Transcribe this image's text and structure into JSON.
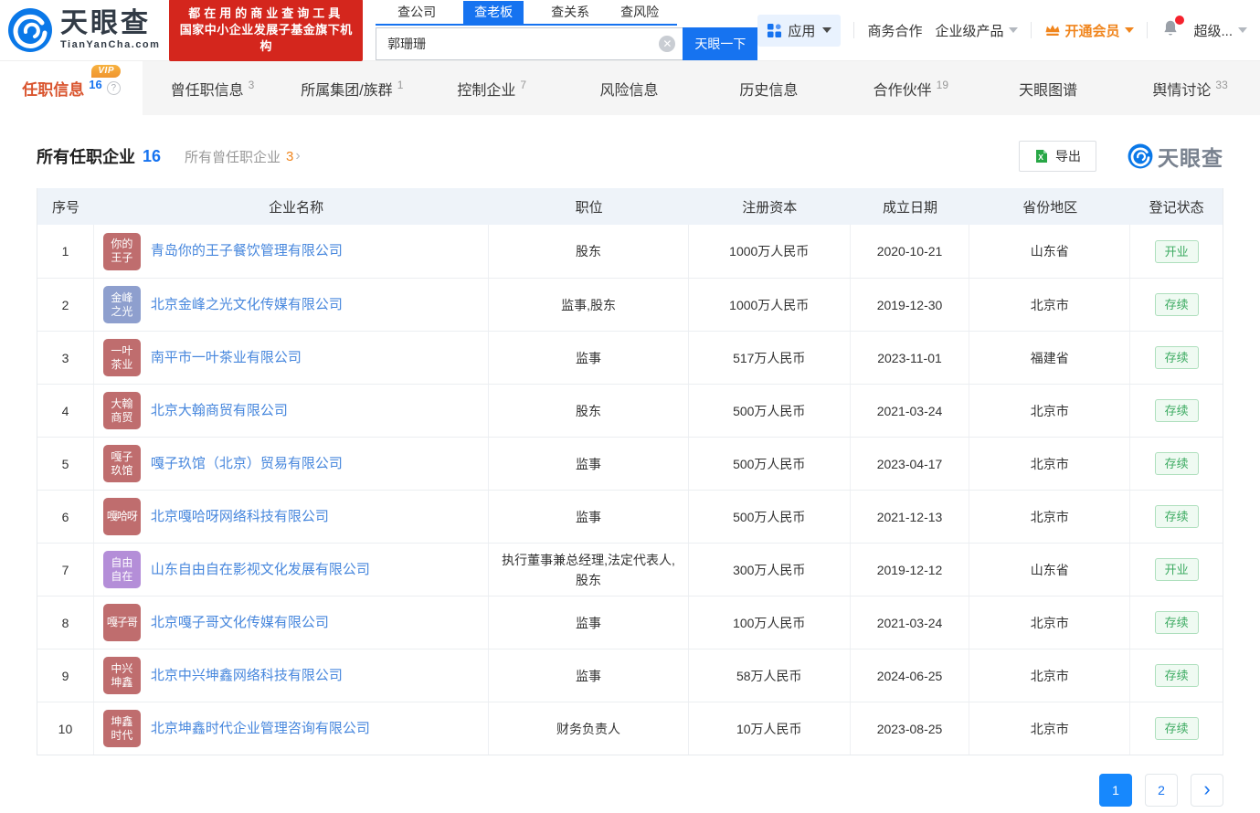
{
  "header": {
    "logo": {
      "title": "天眼查",
      "subtitle": "TianYanCha.com"
    },
    "banner": {
      "line1": "都在用的商业查询工具",
      "line2": "国家中小企业发展子基金旗下机构"
    },
    "search": {
      "tabs": [
        {
          "label": "查公司",
          "active": false
        },
        {
          "label": "查老板",
          "active": true
        },
        {
          "label": "查关系",
          "active": false
        },
        {
          "label": "查风险",
          "active": false
        }
      ],
      "value": "郭珊珊",
      "button": "天眼一下"
    },
    "nav": {
      "apps": "应用",
      "cooperation": "商务合作",
      "enterprise": "企业级产品",
      "vip": "开通会员",
      "username": "超级..."
    }
  },
  "tabs": [
    {
      "label": "任职信息",
      "count": "16",
      "active": true,
      "vip": "VIP",
      "help": true
    },
    {
      "label": "曾任职信息",
      "count": "3"
    },
    {
      "label": "所属集团/族群",
      "count": "1"
    },
    {
      "label": "控制企业",
      "count": "7"
    },
    {
      "label": "风险信息",
      "count": ""
    },
    {
      "label": "历史信息",
      "count": ""
    },
    {
      "label": "合作伙伴",
      "count": "19"
    },
    {
      "label": "天眼图谱",
      "count": ""
    },
    {
      "label": "舆情讨论",
      "count": "33"
    }
  ],
  "section": {
    "title": "所有任职企业",
    "title_count": "16",
    "secondary": "所有曾任职企业",
    "secondary_count": "3",
    "export": "导出",
    "watermark": "天眼查"
  },
  "table": {
    "columns": [
      "序号",
      "企业名称",
      "职位",
      "注册资本",
      "成立日期",
      "省份地区",
      "登记状态"
    ],
    "status_colors": {
      "text": "#3dab62",
      "background": "#effaf2",
      "border": "#aedfbd"
    },
    "rows": [
      {
        "no": "1",
        "logo1": "你的",
        "logo2": "王子",
        "logo_color": "#bf6d6e",
        "company": "青岛你的王子餐饮管理有限公司",
        "position": "股东",
        "capital": "1000万人民币",
        "date": "2020-10-21",
        "region": "山东省",
        "status": "开业"
      },
      {
        "no": "2",
        "logo1": "金峰",
        "logo2": "之光",
        "logo_color": "#8e9fce",
        "company": "北京金峰之光文化传媒有限公司",
        "position": "监事,股东",
        "capital": "1000万人民币",
        "date": "2019-12-30",
        "region": "北京市",
        "status": "存续"
      },
      {
        "no": "3",
        "logo1": "一叶",
        "logo2": "茶业",
        "logo_color": "#bf6d6e",
        "company": "南平市一叶茶业有限公司",
        "position": "监事",
        "capital": "517万人民币",
        "date": "2023-11-01",
        "region": "福建省",
        "status": "存续"
      },
      {
        "no": "4",
        "logo1": "大翰",
        "logo2": "商贸",
        "logo_color": "#bf6d6e",
        "company": "北京大翰商贸有限公司",
        "position": "股东",
        "capital": "500万人民币",
        "date": "2021-03-24",
        "region": "北京市",
        "status": "存续"
      },
      {
        "no": "5",
        "logo1": "嘎子",
        "logo2": "玖馆",
        "logo_color": "#bf6d6e",
        "company": "嘎子玖馆（北京）贸易有限公司",
        "position": "监事",
        "capital": "500万人民币",
        "date": "2023-04-17",
        "region": "北京市",
        "status": "存续"
      },
      {
        "no": "6",
        "logo1": "嘎哈呀",
        "logo2": "",
        "logo_color": "#bf6d6e",
        "company": "北京嘎哈呀网络科技有限公司",
        "position": "监事",
        "capital": "500万人民币",
        "date": "2021-12-13",
        "region": "北京市",
        "status": "存续"
      },
      {
        "no": "7",
        "logo1": "自由",
        "logo2": "自在",
        "logo_color": "#b48ed8",
        "company": "山东自由自在影视文化发展有限公司",
        "position": "执行董事兼总经理,法定代表人,股东",
        "capital": "300万人民币",
        "date": "2019-12-12",
        "region": "山东省",
        "status": "开业"
      },
      {
        "no": "8",
        "logo1": "嘎子哥",
        "logo2": "",
        "logo_color": "#bf6d6e",
        "company": "北京嘎子哥文化传媒有限公司",
        "position": "监事",
        "capital": "100万人民币",
        "date": "2021-03-24",
        "region": "北京市",
        "status": "存续"
      },
      {
        "no": "9",
        "logo1": "中兴",
        "logo2": "坤鑫",
        "logo_color": "#bf6d6e",
        "company": "北京中兴坤鑫网络科技有限公司",
        "position": "监事",
        "capital": "58万人民币",
        "date": "2024-06-25",
        "region": "北京市",
        "status": "存续"
      },
      {
        "no": "10",
        "logo1": "坤鑫",
        "logo2": "时代",
        "logo_color": "#bf6d6e",
        "company": "北京坤鑫时代企业管理咨询有限公司",
        "position": "财务负责人",
        "capital": "10万人民币",
        "date": "2023-08-25",
        "region": "北京市",
        "status": "存续"
      }
    ]
  },
  "pagination": {
    "pages": [
      "1",
      "2"
    ],
    "current": "1"
  }
}
